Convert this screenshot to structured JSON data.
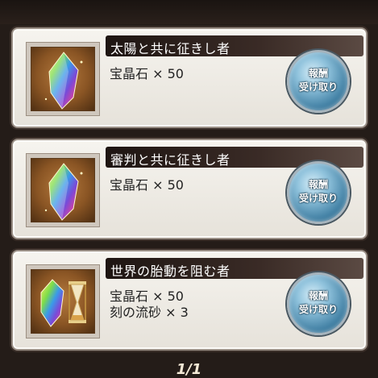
{
  "missions": [
    {
      "title": "太陽と共に征きし者",
      "rewards": [
        "宝晶石 × 50"
      ],
      "items": [
        "crystal"
      ],
      "claim_label": "報酬\n受け取り"
    },
    {
      "title": "審判と共に征きし者",
      "rewards": [
        "宝晶石 × 50"
      ],
      "items": [
        "crystal"
      ],
      "claim_label": "報酬\n受け取り"
    },
    {
      "title": "世界の胎動を阻む者",
      "rewards": [
        "宝晶石 × 50",
        "刻の流砂 × 3"
      ],
      "items": [
        "crystal",
        "hourglass"
      ],
      "claim_label": "報酬\n受け取り"
    }
  ],
  "pager": "1/1",
  "icons": {
    "crystal": "rainbow-crystal-icon",
    "hourglass": "hourglass-icon"
  },
  "colors": {
    "background": "#241c18",
    "title_bar": "#1e1512",
    "claim_button": "#3f7ea2"
  }
}
